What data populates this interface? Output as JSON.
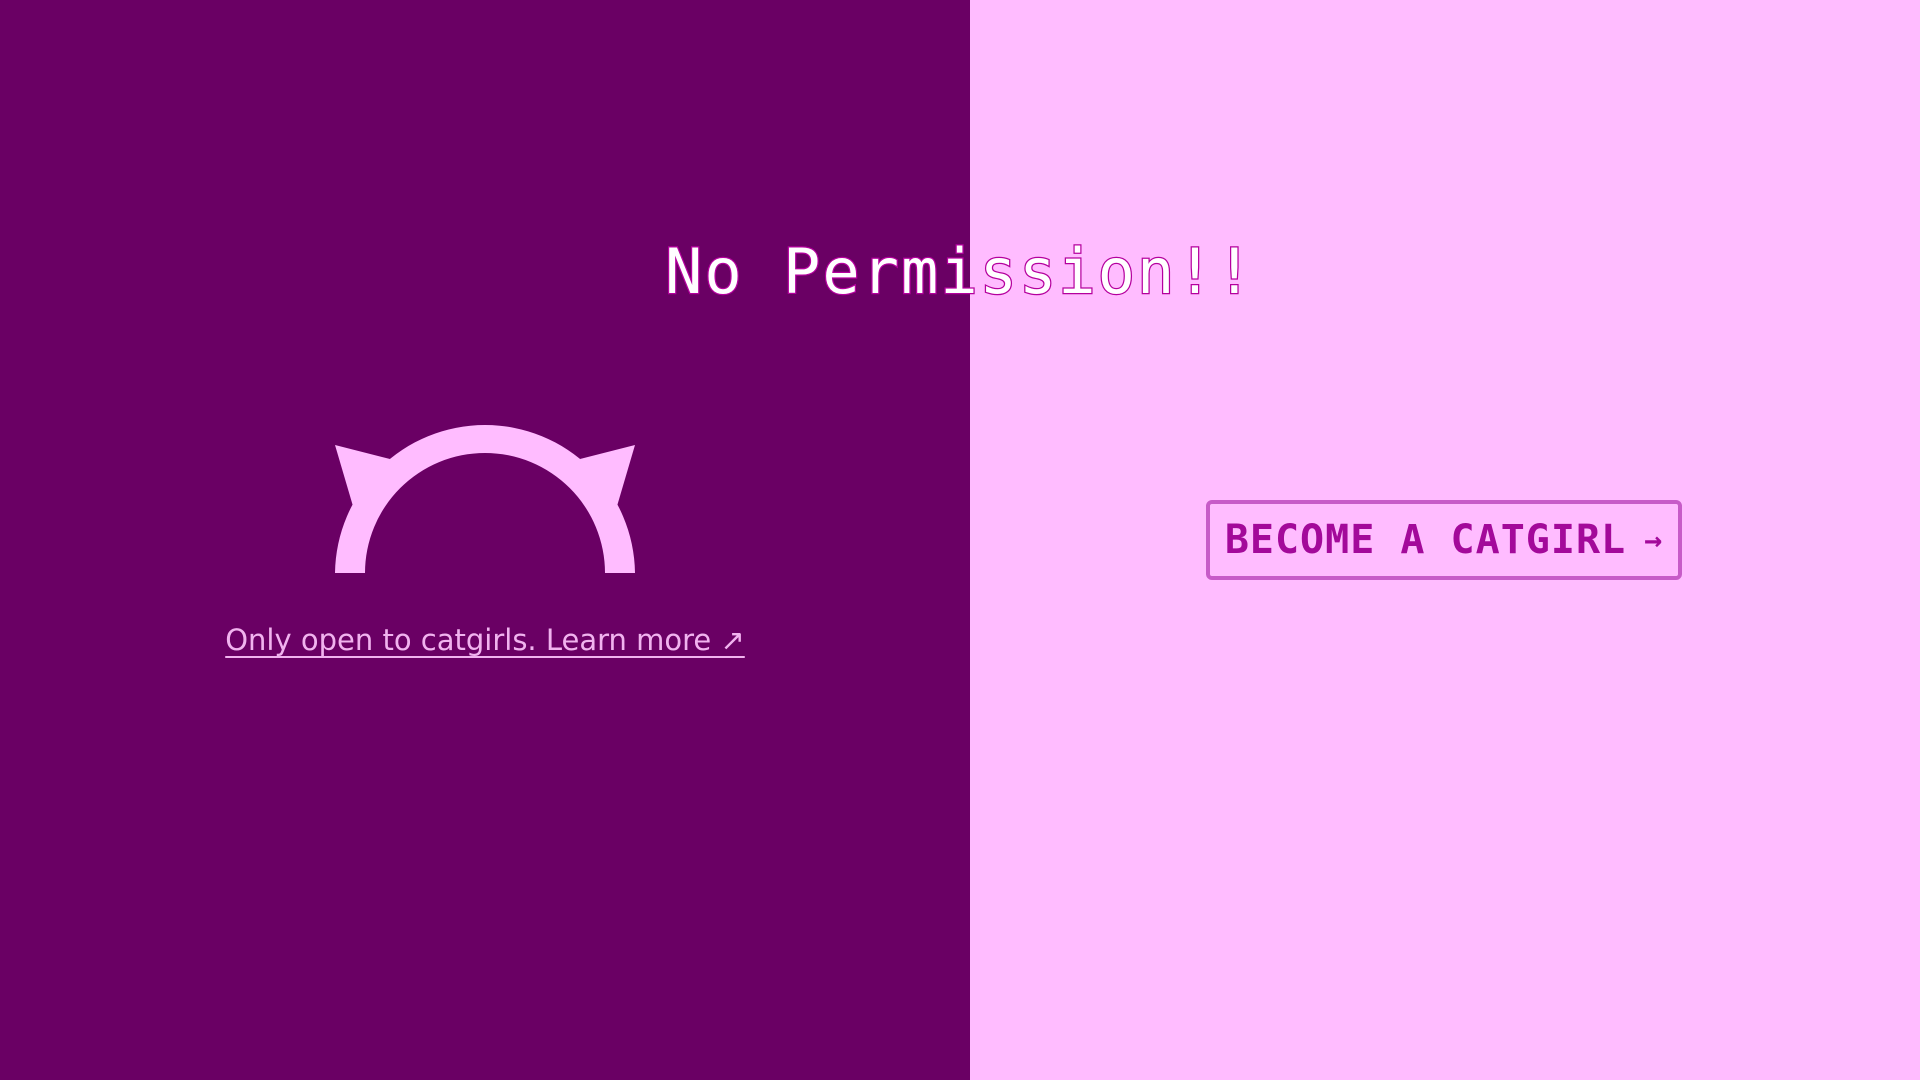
{
  "page": {
    "title": "No Permission!!"
  },
  "left_panel": {
    "link_text": "Only open to catgirls. Learn more ↗",
    "logo_icon": "cat-ears-icon"
  },
  "right_panel": {
    "button_label": "BECOME A CATGIRL",
    "button_arrow": "→"
  },
  "colors": {
    "left_background": "#6a0064",
    "right_background": "#ffbcff",
    "accent": "#a3099a",
    "title_outline": "#b5009e",
    "logo": "#ffbcff",
    "button_border": "#c75bc8"
  }
}
